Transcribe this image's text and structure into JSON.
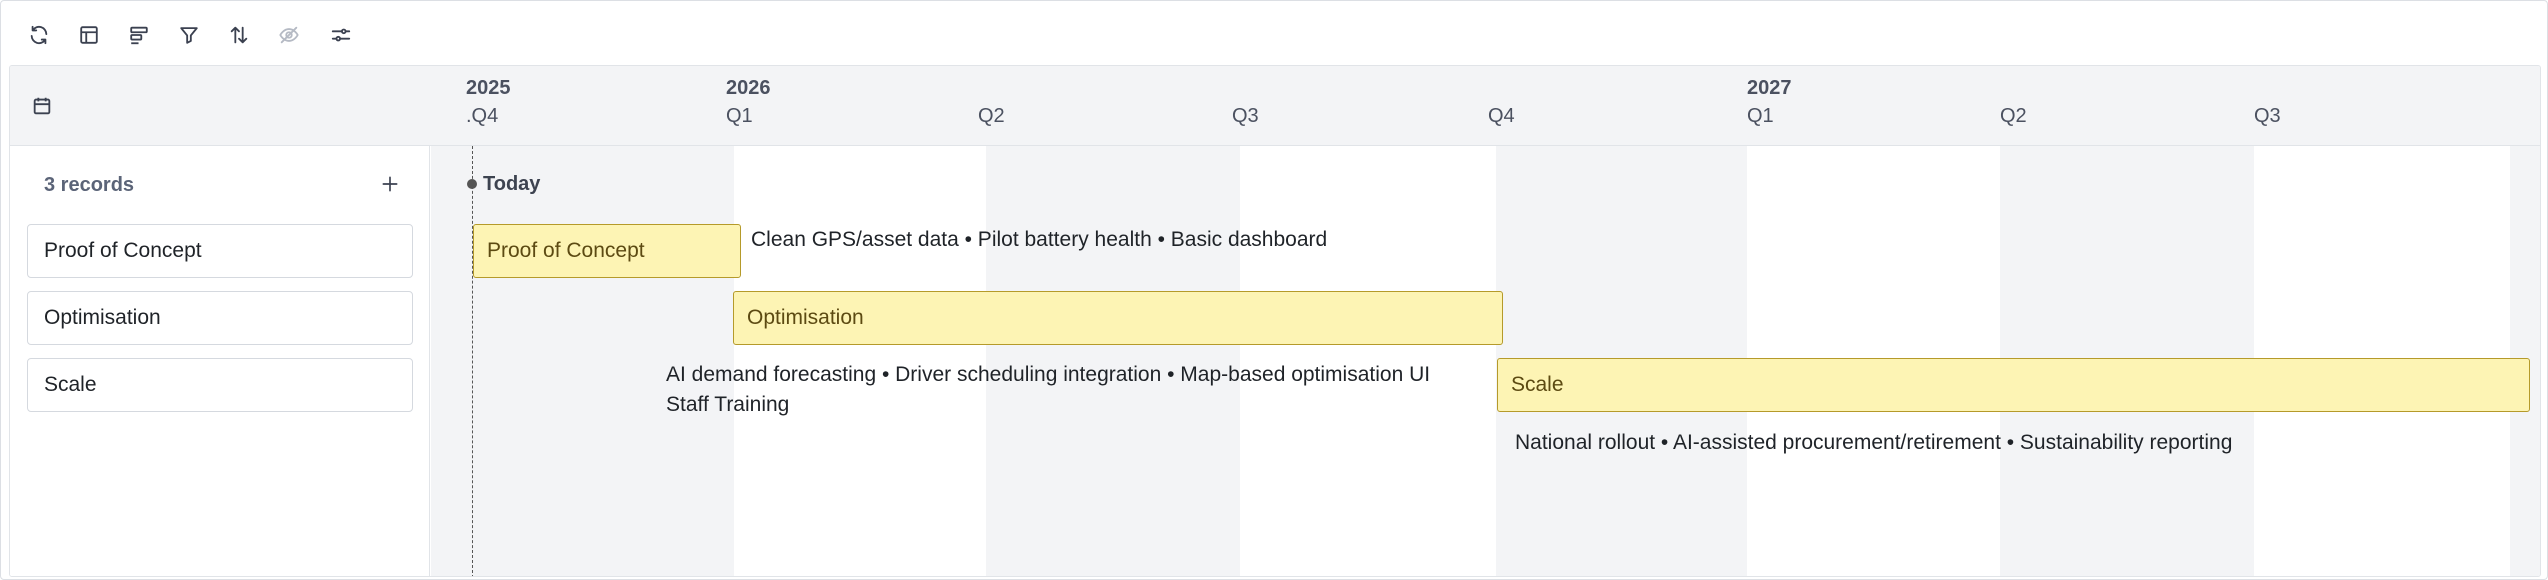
{
  "toolbar": {
    "icons": [
      "refresh-icon",
      "layout-icon",
      "group-icon",
      "filter-icon",
      "sort-icon",
      "hide-fields-icon",
      "settings-sliders-icon"
    ]
  },
  "header": {
    "years": [
      {
        "label": "2025"
      },
      {
        "label": "2026"
      },
      {
        "label": "2027"
      }
    ],
    "quarters": [
      {
        "label": ".Q4"
      },
      {
        "label": "Q1"
      },
      {
        "label": "Q2"
      },
      {
        "label": "Q3"
      },
      {
        "label": "Q4"
      },
      {
        "label": "Q1"
      },
      {
        "label": "Q2"
      },
      {
        "label": "Q3"
      }
    ]
  },
  "records": {
    "count_label": "3 records",
    "items": [
      {
        "label": "Proof of Concept"
      },
      {
        "label": "Optimisation"
      },
      {
        "label": "Scale"
      }
    ]
  },
  "timeline": {
    "today_label": "Today",
    "bars": [
      {
        "label": "Proof of Concept",
        "notes": "Clean GPS/asset data • Pilot battery health • Basic dashboard"
      },
      {
        "label": "Optimisation",
        "notes": "AI demand forecasting • Driver scheduling integration • Map-based optimisation UI",
        "notes_line2": "Staff Training"
      },
      {
        "label": "Scale",
        "notes": "National rollout • AI-assisted procurement/retirement • Sustainability reporting"
      }
    ]
  },
  "colors": {
    "bar_fill": "#fdf4b4",
    "bar_border": "#b59a2a",
    "column_shade": "#f3f4f6"
  }
}
